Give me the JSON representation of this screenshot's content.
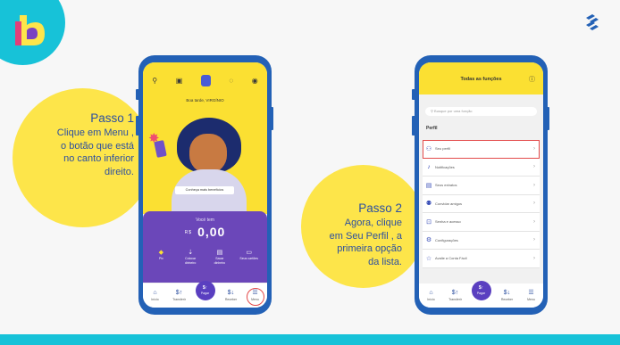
{
  "brand": {
    "accent": "#17c2d8",
    "yellow": "#fde54a",
    "blue": "#2361b6",
    "text_blue": "#2c4fa0",
    "logo_letter": "b"
  },
  "step1": {
    "title": "Passo 1",
    "lines": [
      "Clique em Menu ,",
      "o botão que está",
      "no canto inferior",
      "direito."
    ]
  },
  "step2": {
    "title": "Passo 2",
    "lines": [
      "Agora, clique",
      "em Seu Perfil , a",
      "primeira opção",
      "da lista."
    ]
  },
  "phone1": {
    "greeting": "Boa tarde, VIRGÍNIO",
    "banner": "Conheça mais benefícios",
    "balance_label": "Vocé tem",
    "currency": "R$",
    "balance": "0,00",
    "actions": [
      {
        "icon": "pix-icon",
        "label": "Pix"
      },
      {
        "icon": "deposit-icon",
        "label": "Colocar dinheiro"
      },
      {
        "icon": "withdraw-icon",
        "label": "Sacar dinheiro"
      },
      {
        "icon": "accounts-icon",
        "label": "Seus cartões"
      }
    ],
    "nav": [
      {
        "icon": "home-icon",
        "label": "Início"
      },
      {
        "icon": "transfer-icon",
        "label": "Transferir"
      },
      {
        "icon": "pay-icon",
        "label": "Pagar"
      },
      {
        "icon": "receive-icon",
        "label": "Receber"
      },
      {
        "icon": "menu-icon",
        "label": "Menu"
      }
    ]
  },
  "phone2": {
    "title": "Todas as funções",
    "search_placeholder": "Busque por uma função",
    "section": "Perfil",
    "items": [
      {
        "icon": "user-icon",
        "label": "Seu perfil"
      },
      {
        "icon": "bell-icon",
        "label": "Notificações"
      },
      {
        "icon": "receipt-icon",
        "label": "Seus extratos"
      },
      {
        "icon": "people-icon",
        "label": "Convidar amigos"
      },
      {
        "icon": "lock-icon",
        "label": "Senha e acesso"
      },
      {
        "icon": "gear-icon",
        "label": "Configurações"
      },
      {
        "icon": "star-icon",
        "label": "Avalie a Conta Fácil"
      }
    ],
    "nav": [
      {
        "icon": "home-icon",
        "label": "Início"
      },
      {
        "icon": "transfer-icon",
        "label": "Transferir"
      },
      {
        "icon": "pay-icon",
        "label": "Pagar"
      },
      {
        "icon": "receive-icon",
        "label": "Receber"
      },
      {
        "icon": "menu-icon",
        "label": "Menu"
      }
    ]
  }
}
